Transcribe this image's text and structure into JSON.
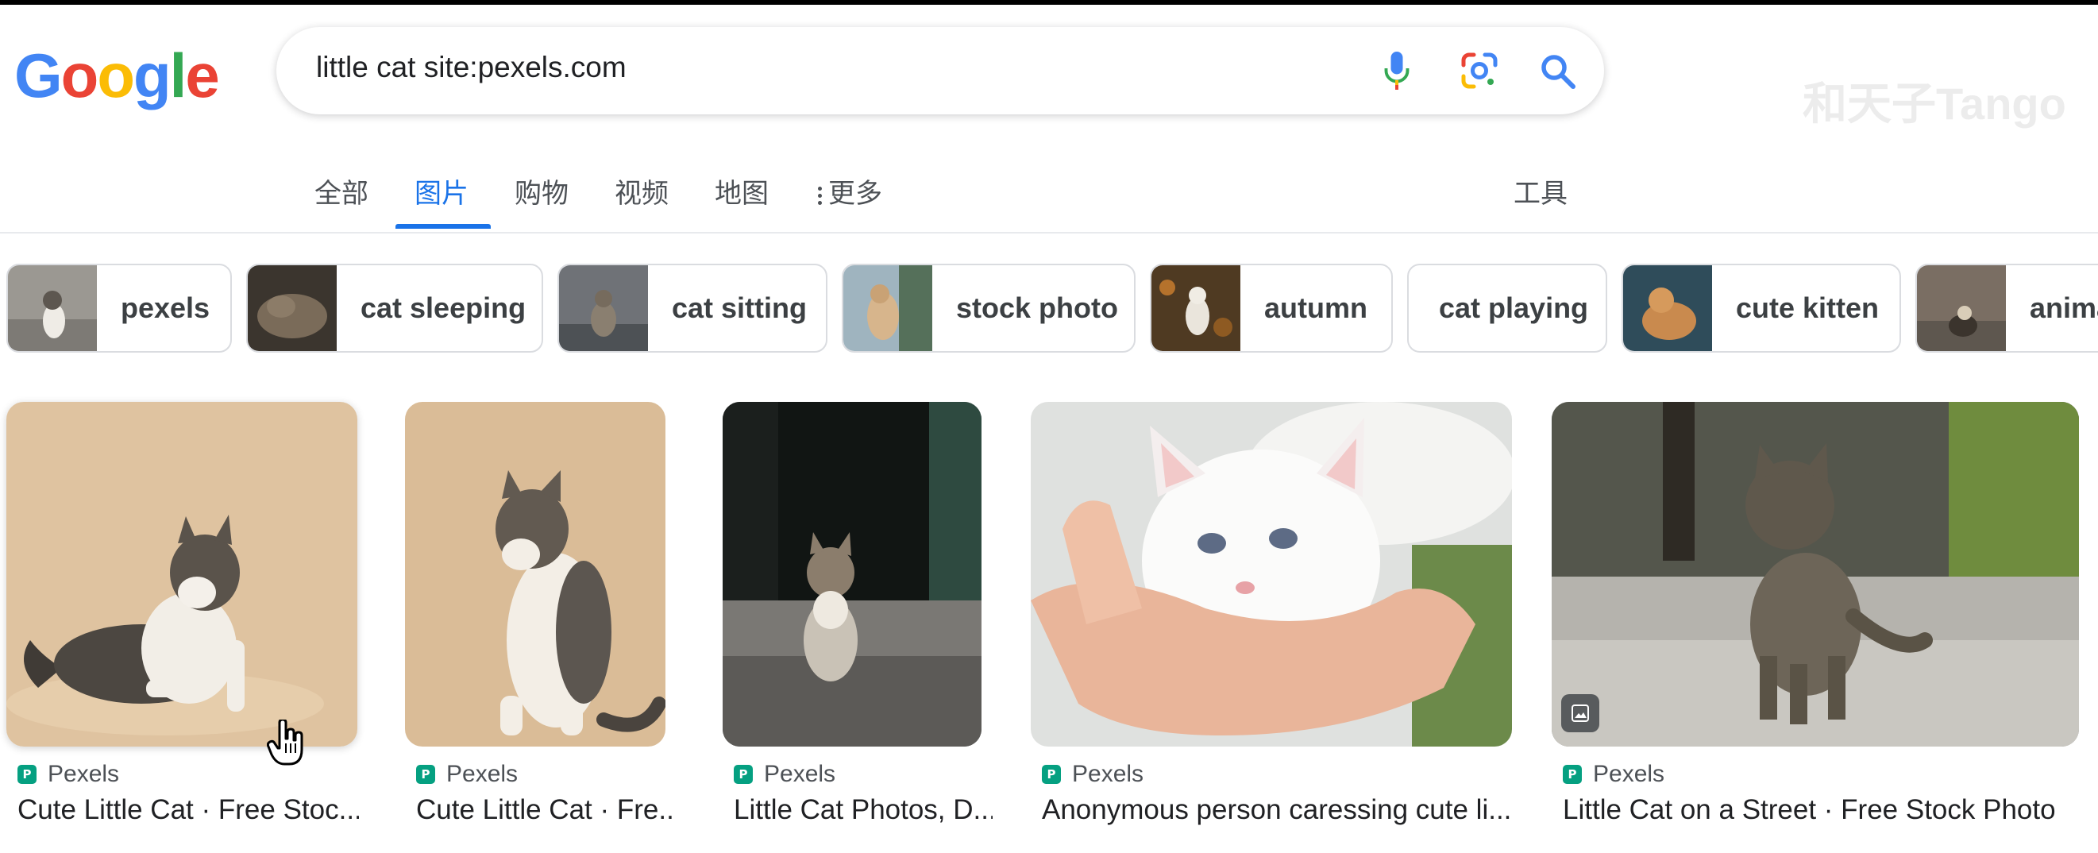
{
  "logo": {
    "letters": [
      "G",
      "o",
      "o",
      "g",
      "l",
      "e"
    ],
    "colors": [
      "#4285f4",
      "#ea4335",
      "#fbbc05",
      "#4285f4",
      "#34a853",
      "#ea4335"
    ]
  },
  "search": {
    "query": "little cat site:pexels.com",
    "icons": [
      "microphone-icon",
      "google-lens-icon",
      "search-icon"
    ]
  },
  "watermark": "和天子Tango",
  "tabs": [
    {
      "label": "全部",
      "active": false
    },
    {
      "label": "图片",
      "active": true
    },
    {
      "label": "购物",
      "active": false
    },
    {
      "label": "视频",
      "active": false
    },
    {
      "label": "地图",
      "active": false
    },
    {
      "label": "更多",
      "active": false,
      "icon": "more-vert-icon"
    }
  ],
  "tools_label": "工具",
  "chips": [
    {
      "label": "pexels"
    },
    {
      "label": "cat sleeping"
    },
    {
      "label": "cat sitting"
    },
    {
      "label": "stock photo"
    },
    {
      "label": "autumn"
    },
    {
      "label": "cat playing"
    },
    {
      "label": "cute kitten"
    },
    {
      "label": "anima"
    }
  ],
  "results": [
    {
      "source": "Pexels",
      "title": "Cute Little Cat · Free Stoc..."
    },
    {
      "source": "Pexels",
      "title": "Cute Little Cat · Fre..."
    },
    {
      "source": "Pexels",
      "title": "Little Cat Photos, D..."
    },
    {
      "source": "Pexels",
      "title": "Anonymous person caressing cute li..."
    },
    {
      "source": "Pexels",
      "title": "Little Cat on a Street · Free Stock Photo"
    }
  ],
  "colors": {
    "accent": "#1a73e8",
    "favicon": "#05a081"
  }
}
